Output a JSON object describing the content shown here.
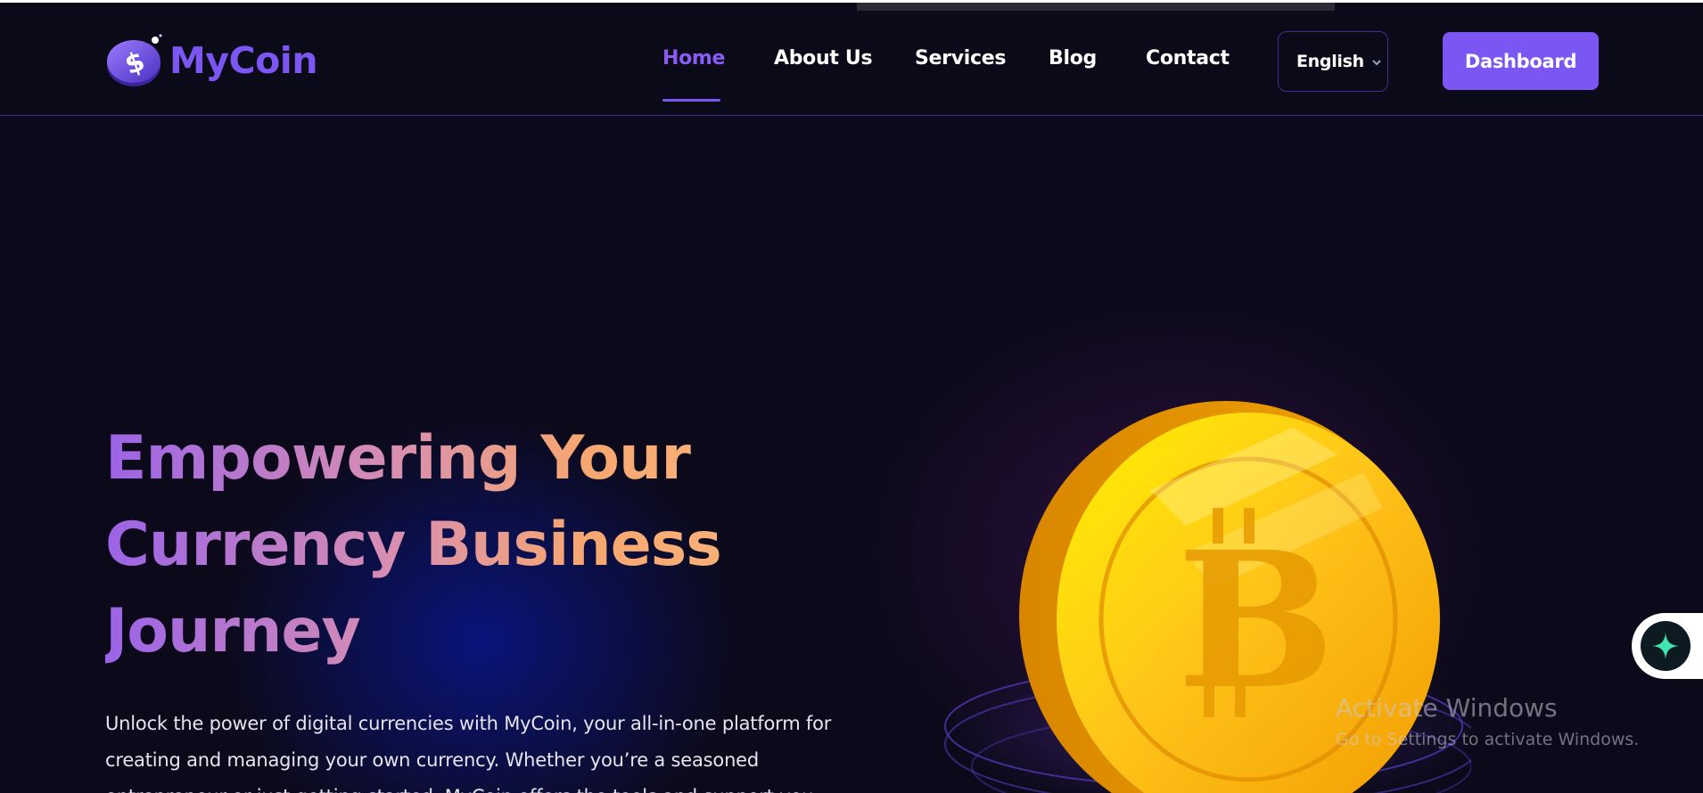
{
  "brand": {
    "name": "MyCoin",
    "accent_color": "#7b56f2",
    "logo_icon": "dollar-coin-icon"
  },
  "nav": {
    "items": [
      {
        "label": "Home",
        "active": true
      },
      {
        "label": "About Us",
        "active": false
      },
      {
        "label": "Services",
        "active": false
      },
      {
        "label": "Blog",
        "active": false
      },
      {
        "label": "Contact",
        "active": false
      }
    ]
  },
  "language": {
    "selected": "English",
    "icon": "chevron-down-icon"
  },
  "actions": {
    "dashboard_label": "Dashboard"
  },
  "hero": {
    "title_lines": [
      "Empowering Your",
      "Currency Business",
      "Journey"
    ],
    "description": "Unlock the power of digital currencies with MyCoin, your all-in-one platform for creating and managing your own currency. Whether you’re a seasoned entrepreneur or just getting started, MyCoin offers the tools and support you",
    "image_icon": "bitcoin-coin-illustration"
  },
  "watermark": {
    "line1": "Activate Windows",
    "line2": "Go to Settings to activate Windows."
  },
  "floating_widget": {
    "icon": "sparkle-icon",
    "icon_color": "#3ee6b0"
  }
}
